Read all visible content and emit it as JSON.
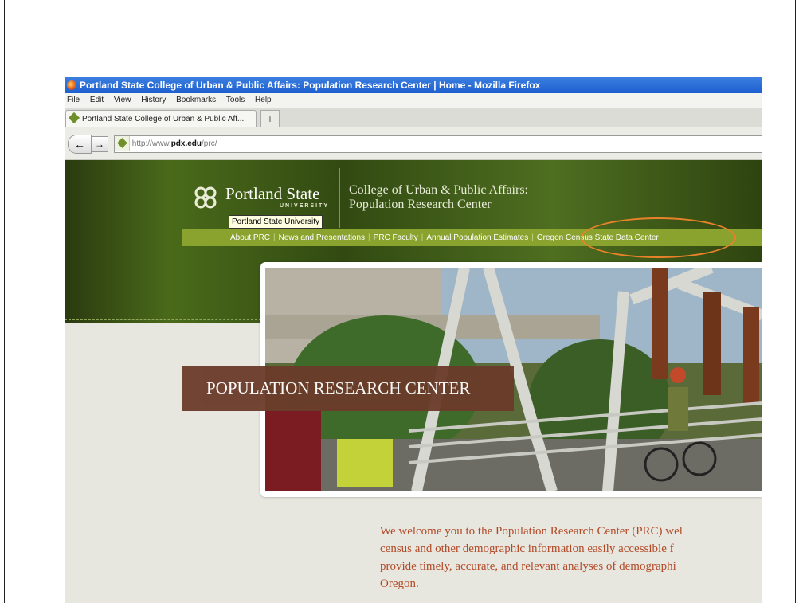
{
  "window": {
    "title": "Portland State College of Urban & Public Affairs: Population Research Center | Home - Mozilla Firefox"
  },
  "menu": [
    "File",
    "Edit",
    "View",
    "History",
    "Bookmarks",
    "Tools",
    "Help"
  ],
  "tab": {
    "label": "Portland State College of Urban & Public Aff...",
    "new_tab": "+"
  },
  "nav": {
    "back": "←",
    "forward": "→",
    "url_prefix": "http://www.",
    "url_domain": "pdx.edu",
    "url_path": "/prc/"
  },
  "site": {
    "logo_name": "Portland State",
    "logo_sub": "UNIVERSITY",
    "college_line1": "College of Urban & Public Affairs:",
    "college_line2": "Population Research Center",
    "tooltip": "Portland State University",
    "nav_items": [
      "About PRC",
      "News and Presentations",
      "PRC Faculty",
      "Annual Population Estimates",
      "Oregon Census State Data Center"
    ],
    "banner": "POPULATION RESEARCH CENTER",
    "welcome": "We welcome you to the Population Research Center (PRC) wel\ncensus and other demographic information easily accessible f\nprovide timely, accurate, and relevant analyses of demographi\nOregon."
  },
  "colors": {
    "title_bar": "#1d5fcf",
    "site_green": "#4a6a1a",
    "nav_green": "#8aa32f",
    "banner_brown": "#6b3b2a",
    "welcome_text": "#b24a28",
    "highlight_ring": "#e8822a"
  }
}
